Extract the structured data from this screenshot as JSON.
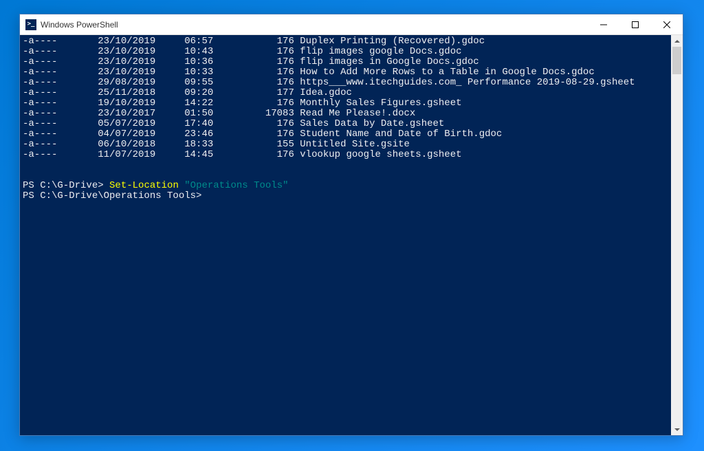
{
  "window": {
    "title": "Windows PowerShell"
  },
  "listing": [
    {
      "mode": "-a----",
      "date": "23/10/2019",
      "time": "06:57",
      "size": "176",
      "name": "Duplex Printing (Recovered).gdoc"
    },
    {
      "mode": "-a----",
      "date": "23/10/2019",
      "time": "10:43",
      "size": "176",
      "name": "flip images google Docs.gdoc"
    },
    {
      "mode": "-a----",
      "date": "23/10/2019",
      "time": "10:36",
      "size": "176",
      "name": "flip images in Google Docs.gdoc"
    },
    {
      "mode": "-a----",
      "date": "23/10/2019",
      "time": "10:33",
      "size": "176",
      "name": "How to Add More Rows to a Table in Google Docs.gdoc"
    },
    {
      "mode": "-a----",
      "date": "29/08/2019",
      "time": "09:55",
      "size": "176",
      "name": "https___www.itechguides.com_ Performance 2019-08-29.gsheet"
    },
    {
      "mode": "-a----",
      "date": "25/11/2018",
      "time": "09:20",
      "size": "177",
      "name": "Idea.gdoc"
    },
    {
      "mode": "-a----",
      "date": "19/10/2019",
      "time": "14:22",
      "size": "176",
      "name": "Monthly Sales Figures.gsheet"
    },
    {
      "mode": "-a----",
      "date": "23/10/2017",
      "time": "01:50",
      "size": "17083",
      "name": "Read Me Please!.docx"
    },
    {
      "mode": "-a----",
      "date": "05/07/2019",
      "time": "17:40",
      "size": "176",
      "name": "Sales Data by Date.gsheet"
    },
    {
      "mode": "-a----",
      "date": "04/07/2019",
      "time": "23:46",
      "size": "176",
      "name": "Student Name and Date of Birth.gdoc"
    },
    {
      "mode": "-a----",
      "date": "06/10/2018",
      "time": "18:33",
      "size": "155",
      "name": "Untitled Site.gsite"
    },
    {
      "mode": "-a----",
      "date": "11/07/2019",
      "time": "14:45",
      "size": "176",
      "name": "vlookup google sheets.gsheet"
    }
  ],
  "prompt1": {
    "prefix": "PS C:\\G-Drive> ",
    "cmd": "Set-Location",
    "arg": "\"Operations Tools\""
  },
  "prompt2": {
    "prefix": "PS C:\\G-Drive\\Operations Tools> "
  }
}
